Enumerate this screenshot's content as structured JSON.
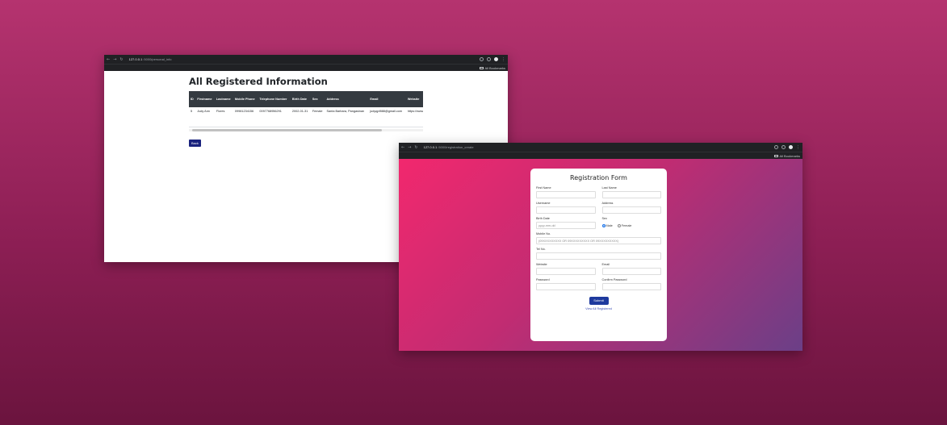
{
  "window1": {
    "url_host": "127.0.0.1",
    "url_path": ":5000/personal_info",
    "bookmarks_label": "All Bookmarks",
    "page_title": "All Registered Information",
    "table": {
      "headers": [
        "ID",
        "Firstname",
        "Lastname",
        "Mobile Phone",
        "Telephone Number",
        "Birth Date",
        "Sex",
        "Address",
        "Email",
        "Website"
      ],
      "rows": [
        [
          "5",
          "Judy Ann",
          "Flores",
          "09981234156",
          "0097768956291",
          "2002-01-31",
          "Female",
          "Santa Barbara, Pangasinan",
          "judyqpf888@gmail.com",
          "https://www.facebook.com"
        ]
      ]
    },
    "back_label": "Back"
  },
  "window2": {
    "url_host": "127.0.0.1",
    "url_path": ":5000/registration_create",
    "bookmarks_label": "All Bookmarks",
    "form": {
      "title": "Registration Form",
      "first_name_label": "First Name",
      "last_name_label": "Last Name",
      "username_label": "Username",
      "address_label": "Address",
      "birth_date_label": "Birth Date",
      "birth_date_placeholder": "yyyy-mm-dd",
      "sex_label": "Sex",
      "sex_options": [
        "Male",
        "Female"
      ],
      "sex_selected": "Male",
      "mobile_label": "Mobile No.",
      "mobile_placeholder": "(09XXXXXXXXX OR 09XXXXXXXXX OR 09XXXXXXXXX)",
      "tel_label": "Tel No.",
      "website_label": "Website",
      "email_label": "Email",
      "password_label": "Password",
      "confirm_password_label": "Confirm Password",
      "submit_label": "Submit",
      "view_link": "View All Registered"
    }
  },
  "colors": {
    "background": "#a52962",
    "table_header": "#343a40",
    "button": "#1e3a9e",
    "form_gradient_start": "#f2286e",
    "form_gradient_end": "#6b3f87"
  }
}
